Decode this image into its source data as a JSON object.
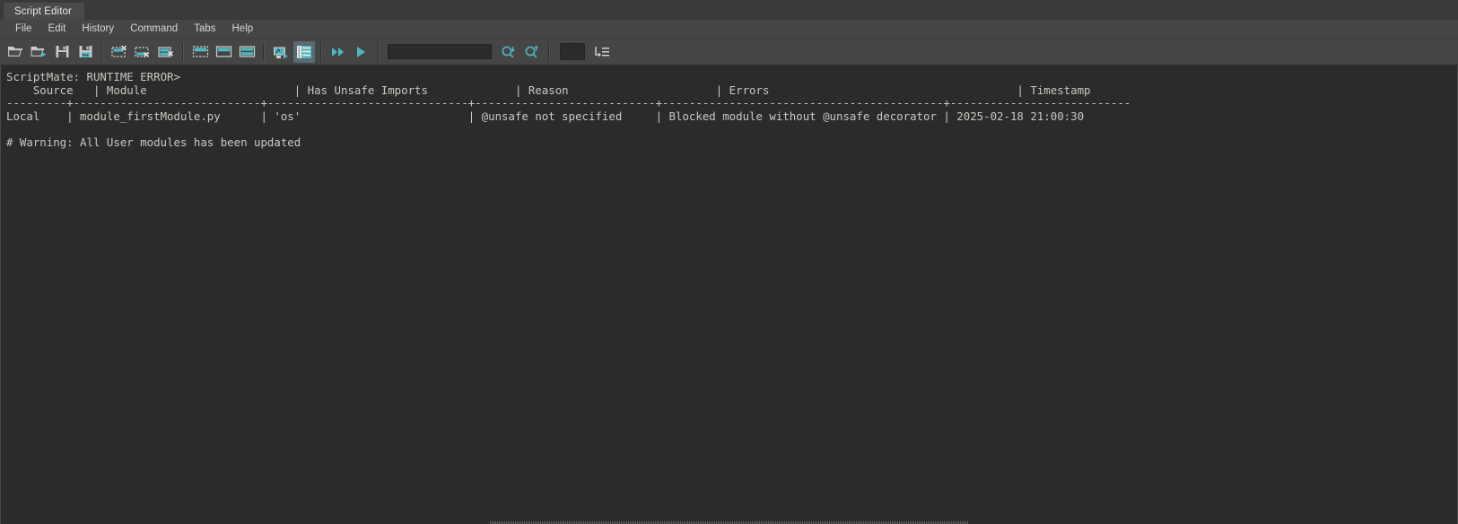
{
  "window": {
    "tab_title": "Script Editor"
  },
  "menubar": {
    "items": [
      {
        "label": "File"
      },
      {
        "label": "Edit"
      },
      {
        "label": "History"
      },
      {
        "label": "Command"
      },
      {
        "label": "Tabs"
      },
      {
        "label": "Help"
      }
    ]
  },
  "toolbar": {
    "buttons": [
      {
        "name": "open-script-button",
        "icon": "folder-open-icon"
      },
      {
        "name": "open-script-run-button",
        "icon": "folder-open-arrow-icon"
      },
      {
        "name": "save-script-button",
        "icon": "floppy-disk-icon"
      },
      {
        "name": "save-script-as-button",
        "icon": "floppy-disk-plus-icon"
      },
      {
        "name": "clear-history-button",
        "icon": "clear-history-icon"
      },
      {
        "name": "clear-input-button",
        "icon": "clear-input-icon"
      },
      {
        "name": "clear-all-button",
        "icon": "clear-all-icon"
      },
      {
        "name": "layout-history-only-button",
        "icon": "layout-top-icon"
      },
      {
        "name": "layout-input-only-button",
        "icon": "layout-bottom-icon"
      },
      {
        "name": "layout-split-button",
        "icon": "layout-split-icon"
      },
      {
        "name": "show-line-echo-button",
        "icon": "echo-all-icon"
      },
      {
        "name": "show-line-numbers-button",
        "icon": "line-numbers-icon",
        "active": true
      },
      {
        "name": "execute-all-button",
        "icon": "double-play-icon"
      },
      {
        "name": "execute-selection-button",
        "icon": "play-icon"
      }
    ],
    "search_value": "",
    "search_placeholder": "",
    "find-prev_icon": "search-down-icon",
    "find-next_icon": "search-up-icon",
    "indent_box_value": "",
    "indent_icon": "indent-region-icon"
  },
  "output": {
    "lines": [
      "ScriptMate: RUNTIME ERROR>",
      "    Source   | Module                      | Has Unsafe Imports             | Reason                      | Errors                                     | Timestamp",
      "---------+----------------------------+------------------------------+---------------------------+------------------------------------------+---------------------------",
      "Local    | module_firstModule.py      | 'os'                         | @unsafe not specified     | Blocked module without @unsafe decorator | 2025-02-18 21:00:30",
      "",
      "# Warning: All User modules has been updated"
    ],
    "table": {
      "headers": [
        "Source",
        "Module",
        "Has Unsafe Imports",
        "Reason",
        "Errors",
        "Timestamp"
      ],
      "rows": [
        {
          "Source": "Local",
          "Module": "module_firstModule.py",
          "Has Unsafe Imports": "'os'",
          "Reason": "@unsafe not specified",
          "Errors": "Blocked module without @unsafe decorator",
          "Timestamp": "2025-02-18 21:00:30"
        }
      ]
    },
    "prompt_label": "ScriptMate: RUNTIME ERROR>",
    "warning_text": "# Warning: All User modules has been updated"
  },
  "colors": {
    "accent_teal": "#4db8c0",
    "toolbar_bg": "#454545",
    "console_bg": "#2b2b2b",
    "text": "#c8c8c2",
    "active_button_bg": "#5b6a72"
  }
}
